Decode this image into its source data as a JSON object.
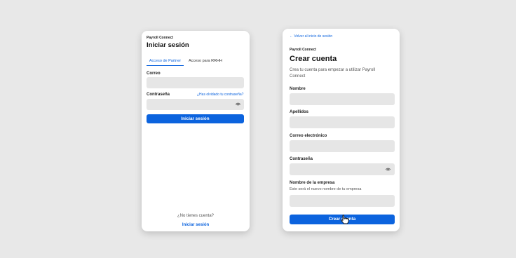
{
  "login": {
    "brand": "Payroll Connect",
    "title": "Iniciar sesión",
    "tabs": [
      {
        "label": "Acceso de Partner"
      },
      {
        "label": "Acceso para RRHH"
      }
    ],
    "email_label": "Correo",
    "password_label": "Contraseña",
    "forgot_link": "¿Has olvidado tu contraseña?",
    "submit_label": "Iniciar sesión",
    "footer_question": "¿No tienes cuenta?",
    "footer_link": "Iniciar sesión"
  },
  "signup": {
    "back_link": "Volver al inicio de sesión",
    "brand": "Payroll Connect",
    "title": "Crear cuenta",
    "subtitle": "Crea tu cuenta para empezar a utilizar Payroll Connect",
    "fields": {
      "first_name": "Nombre",
      "last_name": "Apellidos",
      "email": "Correo electrónico",
      "password": "Contraseña",
      "company": "Nombre de la empresa"
    },
    "company_hint": "Este será el nuevo nombre de tu empresa",
    "submit_label": "Crear cuenta"
  },
  "colors": {
    "accent": "#0b63de",
    "field_bg": "#e6e6e6",
    "page_bg": "#e8e8e8"
  },
  "icons": {
    "password_toggle": "eye-icon",
    "back": "arrow-left-icon",
    "cursor": "hand-pointer-icon"
  }
}
